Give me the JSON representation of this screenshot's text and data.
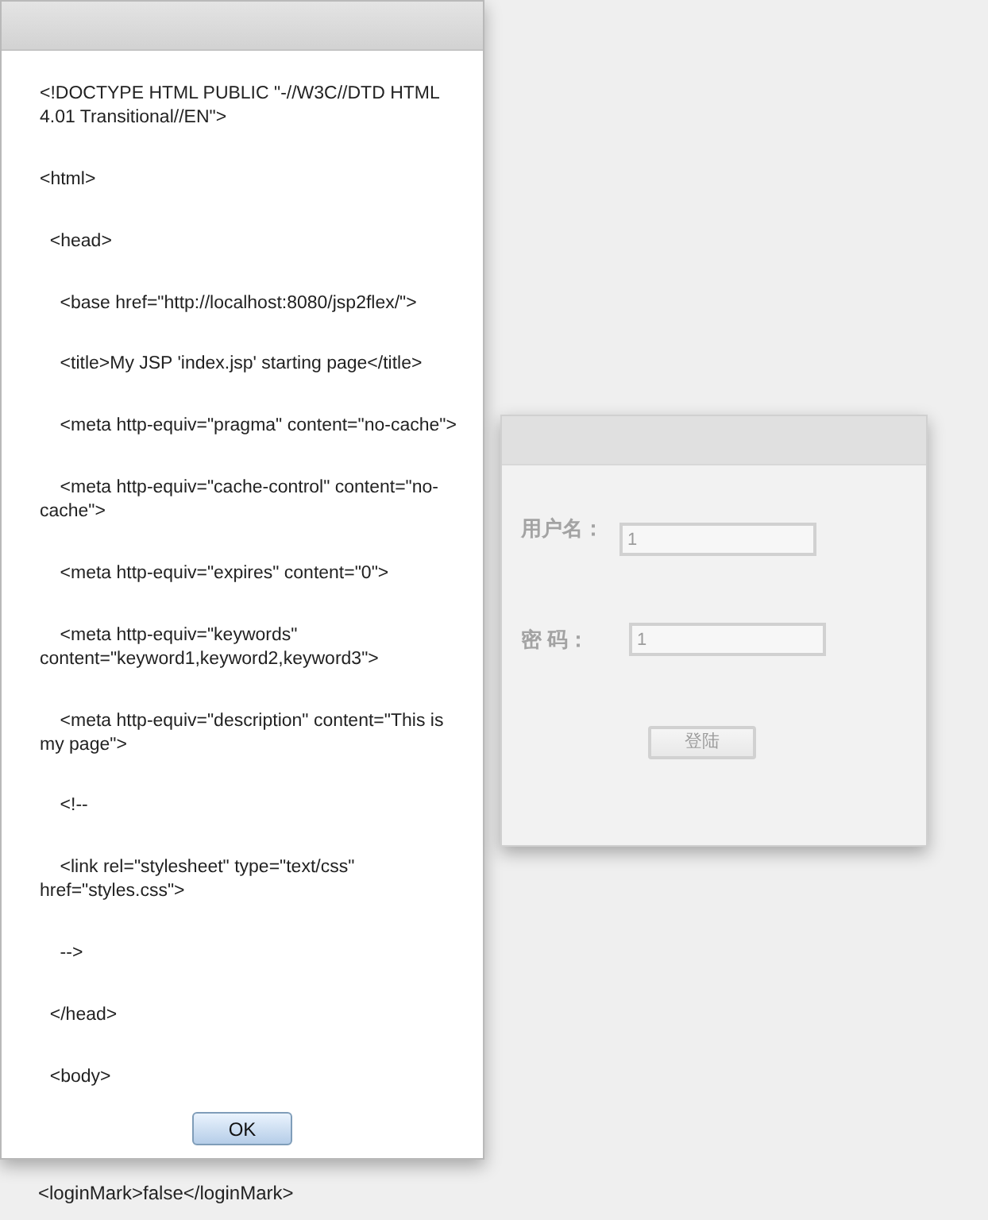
{
  "source_dialog": {
    "lines": [
      {
        "text": "<!DOCTYPE HTML PUBLIC \"-//W3C//DTD HTML 4.01 Transitional//EN\">"
      },
      {
        "text": "<html>"
      },
      {
        "text": "  <head>"
      },
      {
        "text": "    <base href=\"http://localhost:8080/jsp2flex/\">"
      },
      {
        "text": "    <title>My JSP 'index.jsp' starting page</title>"
      },
      {
        "text": "    <meta http-equiv=\"pragma\" content=\"no-cache\">"
      },
      {
        "text": "    <meta http-equiv=\"cache-control\" content=\"no-cache\">"
      },
      {
        "text": "    <meta http-equiv=\"expires\" content=\"0\">"
      },
      {
        "text": "    <meta http-equiv=\"keywords\" content=\"keyword1,keyword2,keyword3\">"
      },
      {
        "text": "    <meta http-equiv=\"description\" content=\"This is my page\">"
      },
      {
        "text": "    <!--"
      },
      {
        "text": "    <link rel=\"stylesheet\" type=\"text/css\" href=\"styles.css\">"
      },
      {
        "text": "    -->"
      },
      {
        "text": "  </head>"
      },
      {
        "text": "  <body>"
      }
    ],
    "ok_button": "OK"
  },
  "login_panel": {
    "disabled": true,
    "fields": [
      {
        "label": "用户名：",
        "value": "1"
      },
      {
        "label": "密 码：",
        "value": "1"
      }
    ],
    "login_button": "登陆"
  },
  "output_text": "<loginMark>false</loginMark>"
}
